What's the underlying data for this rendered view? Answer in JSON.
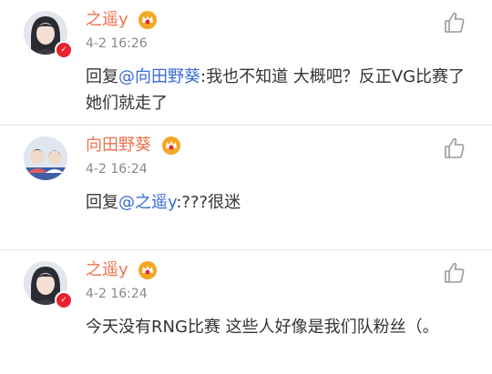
{
  "comments": [
    {
      "author": "之遥y",
      "time": "4-2 16:26",
      "reply_prefix": "回复",
      "mention": "@向田野葵",
      "text": ":我也不知道 大概吧？反正VG比赛了 她们就走了"
    },
    {
      "author": "向田野葵",
      "time": "4-2 16:24",
      "reply_prefix": "回复",
      "mention": "@之遥y",
      "text": ":???很迷"
    },
    {
      "author": "之遥y",
      "time": "4-2 16:24",
      "text": "今天没有RNG比赛 这些人好像是我们队粉丝（。"
    }
  ],
  "icons": {
    "like": "thumbs-up-icon",
    "verified": "verified-v-icon",
    "member": "vip-crown-icon"
  },
  "colors": {
    "username": "#eb7350",
    "mention": "#3b6bd4",
    "timestamp": "#888888",
    "verified_badge": "#e8232c",
    "vip_badge": "#f5a623"
  }
}
